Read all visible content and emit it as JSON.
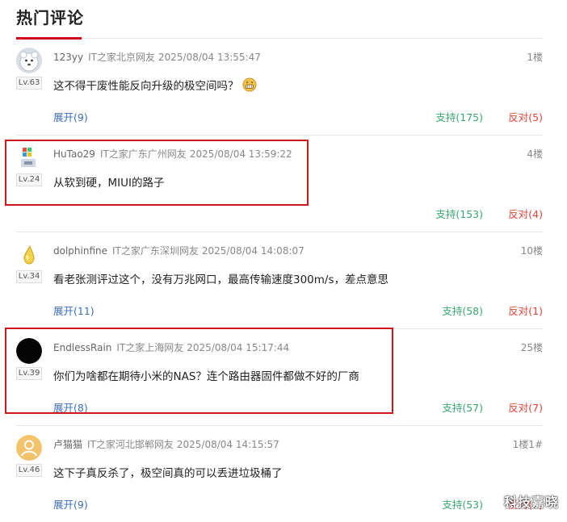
{
  "section_title": "热门评论",
  "comments": [
    {
      "user": "123yy",
      "source": "IT之家北京网友",
      "time": "2025/08/04 13:55:47",
      "floor": "1楼",
      "level": "Lv.63",
      "text": "这不得干废性能反向升级的极空间吗？",
      "emoji": "grin-emoji",
      "expand": "展开(9)",
      "support": "支持(175)",
      "oppose": "反对(5)",
      "avatar": "white-bear-avatar"
    },
    {
      "user": "HuTao29",
      "source": "IT之家广东广州网友",
      "time": "2025/08/04 13:59:22",
      "floor": "4楼",
      "level": "Lv.24",
      "text": "从软到硬，MIUI的路子",
      "support": "支持(153)",
      "oppose": "反对(4)",
      "avatar": "pixel-logo-avatar"
    },
    {
      "user": "dolphinfine",
      "source": "IT之家广东深圳网友",
      "time": "2025/08/04 14:08:07",
      "floor": "10楼",
      "level": "Lv.34",
      "text": "看老张测评过这个，没有万兆网口，最高传输速度300m/s，差点意思",
      "expand": "展开(11)",
      "support": "支持(58)",
      "oppose": "反对(1)",
      "avatar": "yellow-drop-avatar"
    },
    {
      "user": "EndlessRain",
      "source": "IT之家上海网友",
      "time": "2025/08/04 15:17:44",
      "floor": "25楼",
      "level": "Lv.39",
      "text": "你们为啥都在期待小米的NAS？连个路由器固件都做不好的厂商",
      "expand": "展开(8)",
      "support": "支持(57)",
      "oppose": "反对(7)",
      "avatar": "black-circle-avatar"
    },
    {
      "user": "卢猫猫",
      "source": "IT之家河北邯郸网友",
      "time": "2025/08/04 14:15:57",
      "floor": "1楼1#",
      "level": "Lv.46",
      "text": "这下子真反杀了，极空间真的可以丢进垃圾桶了",
      "expand": "展开(9)",
      "support": "支持(53)",
      "oppose": "反对(5)",
      "avatar": "default-user-avatar"
    }
  ],
  "watermark": "科技嘉晓",
  "colors": {
    "accent": "#d0021b",
    "support": "#3aa772",
    "oppose": "#e0453a",
    "link": "#3c6fb8",
    "highlight": "#d1161b"
  }
}
